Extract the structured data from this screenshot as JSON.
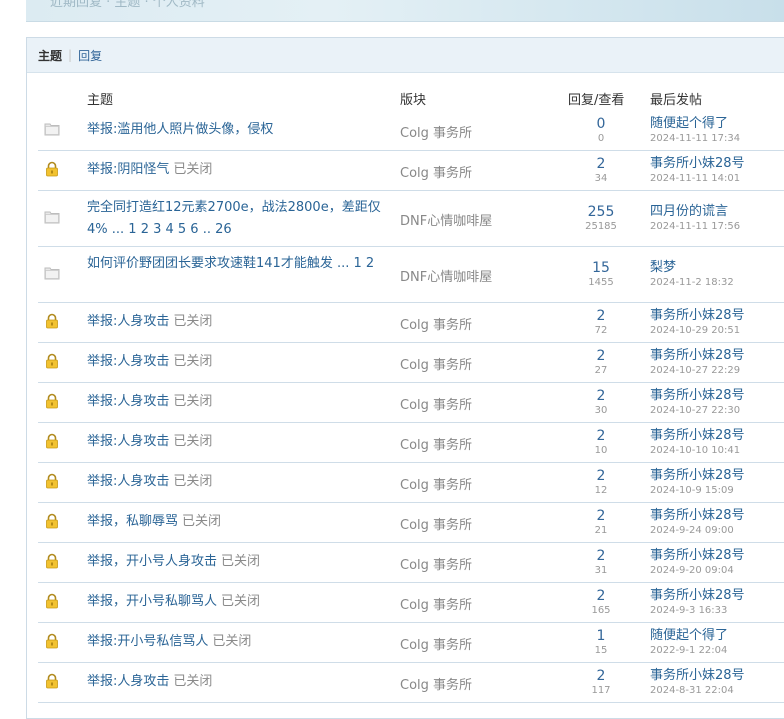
{
  "banner": {
    "faint_text": "近期回复 · 主题 · 个人资料"
  },
  "tabs": [
    {
      "label": "主题",
      "active": true
    },
    {
      "label": "回复",
      "active": false
    }
  ],
  "columns": {
    "topic": "主题",
    "forum": "版块",
    "stats": "回复/查看",
    "last": "最后发帖"
  },
  "rows": [
    {
      "icon": "folder-icon",
      "title": "举报:滥用他人照片做头像，侵权",
      "closed": "",
      "pages": "",
      "forum": "Colg 事务所",
      "replies": "0",
      "views": "0",
      "last_user": "随便起个得了",
      "last_time": "2024-11-11 17:34",
      "tall": false
    },
    {
      "icon": "lock-icon",
      "title": "举报:阴阳怪气",
      "closed": "已关闭",
      "pages": "",
      "forum": "Colg 事务所",
      "replies": "2",
      "views": "34",
      "last_user": "事务所小妹28号",
      "last_time": "2024-11-11 14:01",
      "tall": false
    },
    {
      "icon": "folder-icon",
      "title": "完全同打造红12元素2700e，战法2800e，差距仅4%",
      "closed": "",
      "pages": "... 1 2 3 4 5 6 .. 26",
      "forum": "DNF心情咖啡屋",
      "replies": "255",
      "views": "25185",
      "last_user": "四月份的谎言",
      "last_time": "2024-11-11 17:56",
      "tall": true
    },
    {
      "icon": "folder-icon",
      "title": "如何评价野团团长要求攻速鞋141才能触发",
      "closed": "",
      "pages": "... 1 2",
      "forum": "DNF心情咖啡屋",
      "replies": "15",
      "views": "1455",
      "last_user": "梨梦",
      "last_time": "2024-11-2 18:32",
      "tall": true
    },
    {
      "icon": "lock-icon",
      "title": "举报:人身攻击",
      "closed": "已关闭",
      "pages": "",
      "forum": "Colg 事务所",
      "replies": "2",
      "views": "72",
      "last_user": "事务所小妹28号",
      "last_time": "2024-10-29 20:51",
      "tall": false
    },
    {
      "icon": "lock-icon",
      "title": "举报:人身攻击",
      "closed": "已关闭",
      "pages": "",
      "forum": "Colg 事务所",
      "replies": "2",
      "views": "27",
      "last_user": "事务所小妹28号",
      "last_time": "2024-10-27 22:29",
      "tall": false
    },
    {
      "icon": "lock-icon",
      "title": "举报:人身攻击",
      "closed": "已关闭",
      "pages": "",
      "forum": "Colg 事务所",
      "replies": "2",
      "views": "30",
      "last_user": "事务所小妹28号",
      "last_time": "2024-10-27 22:30",
      "tall": false
    },
    {
      "icon": "lock-icon",
      "title": "举报:人身攻击",
      "closed": "已关闭",
      "pages": "",
      "forum": "Colg 事务所",
      "replies": "2",
      "views": "10",
      "last_user": "事务所小妹28号",
      "last_time": "2024-10-10 10:41",
      "tall": false
    },
    {
      "icon": "lock-icon",
      "title": "举报:人身攻击",
      "closed": "已关闭",
      "pages": "",
      "forum": "Colg 事务所",
      "replies": "2",
      "views": "12",
      "last_user": "事务所小妹28号",
      "last_time": "2024-10-9 15:09",
      "tall": false
    },
    {
      "icon": "lock-icon",
      "title": "举报，私聊辱骂",
      "closed": "已关闭",
      "pages": "",
      "forum": "Colg 事务所",
      "replies": "2",
      "views": "21",
      "last_user": "事务所小妹28号",
      "last_time": "2024-9-24 09:00",
      "tall": false
    },
    {
      "icon": "lock-icon",
      "title": "举报，开小号人身攻击",
      "closed": "已关闭",
      "pages": "",
      "forum": "Colg 事务所",
      "replies": "2",
      "views": "31",
      "last_user": "事务所小妹28号",
      "last_time": "2024-9-20 09:04",
      "tall": false
    },
    {
      "icon": "lock-icon",
      "title": "举报，开小号私聊骂人",
      "closed": "已关闭",
      "pages": "",
      "forum": "Colg 事务所",
      "replies": "2",
      "views": "165",
      "last_user": "事务所小妹28号",
      "last_time": "2024-9-3 16:33",
      "tall": false
    },
    {
      "icon": "lock-icon",
      "title": "举报:开小号私信骂人",
      "closed": "已关闭",
      "pages": "",
      "forum": "Colg 事务所",
      "replies": "1",
      "views": "15",
      "last_user": "随便起个得了",
      "last_time": "2022-9-1 22:04",
      "tall": false
    },
    {
      "icon": "lock-icon",
      "title": "举报:人身攻击",
      "closed": "已关闭",
      "pages": "",
      "forum": "Colg 事务所",
      "replies": "2",
      "views": "117",
      "last_user": "事务所小妹28号",
      "last_time": "2024-8-31 22:04",
      "tall": false
    }
  ]
}
